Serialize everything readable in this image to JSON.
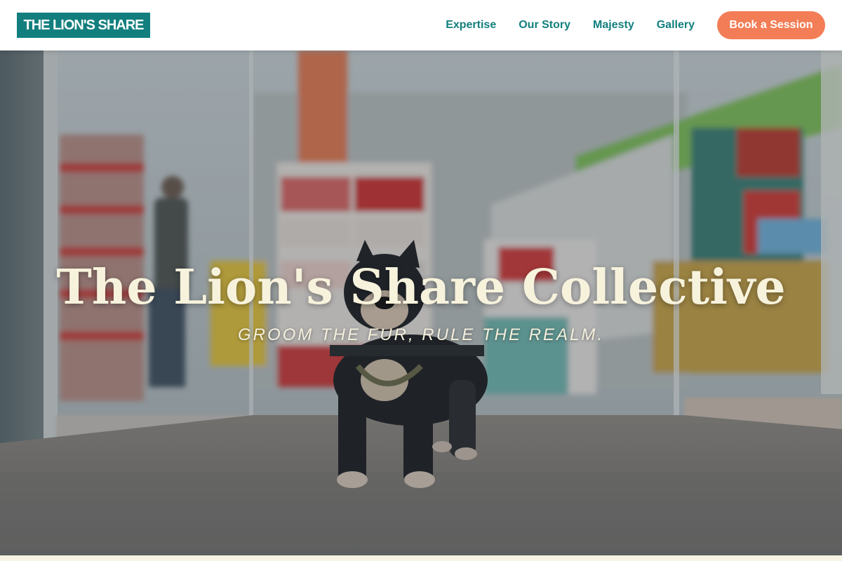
{
  "header": {
    "logo_text": "THE LION'S SHARE",
    "nav": [
      {
        "label": "Expertise"
      },
      {
        "label": "Our Story"
      },
      {
        "label": "Majesty"
      },
      {
        "label": "Gallery"
      }
    ],
    "cta_label": "Book a Session"
  },
  "hero": {
    "title": "The Lion's Share Collective",
    "tagline": "GROOM THE FUR, RULE THE REALM."
  },
  "colors": {
    "brand_teal": "#127f7e",
    "cta_coral": "#f27d56",
    "hero_text": "#f7f2dc",
    "page_bg": "#f7f4e3"
  }
}
